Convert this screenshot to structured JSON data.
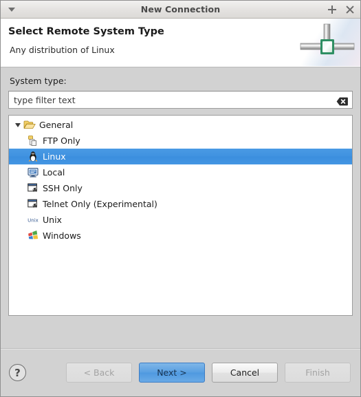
{
  "window": {
    "title": "New Connection",
    "menu_icon": "chevron-down-icon",
    "maximize_label": "+",
    "close_label": "×"
  },
  "banner": {
    "title": "Select Remote System Type",
    "subtitle": "Any distribution of Linux",
    "art_icon": "network-connection-icon"
  },
  "form": {
    "system_type_label": "System type:",
    "filter_value": "type filter text",
    "filter_placeholder": "type filter text",
    "clear_icon": "clear-backspace-icon"
  },
  "tree": {
    "root": {
      "label": "General",
      "icon": "open-folder-icon",
      "expander": "triangle-down-icon",
      "expanded": true
    },
    "items": [
      {
        "label": "FTP Only",
        "icon": "ftp-pages-icon",
        "selected": false
      },
      {
        "label": "Linux",
        "icon": "linux-penguin-icon",
        "selected": true
      },
      {
        "label": "Local",
        "icon": "local-monitor-icon",
        "selected": false
      },
      {
        "label": "SSH Only",
        "icon": "ssh-window-icon",
        "selected": false
      },
      {
        "label": "Telnet Only (Experimental)",
        "icon": "telnet-window-icon",
        "selected": false
      },
      {
        "label": "Unix",
        "icon": "unix-text-icon",
        "selected": false
      },
      {
        "label": "Windows",
        "icon": "windows-flag-icon",
        "selected": false
      }
    ]
  },
  "footer": {
    "help_label": "?",
    "help_icon": "help-question-icon",
    "buttons": [
      {
        "label": "< Back",
        "state": "disabled"
      },
      {
        "label": "Next >",
        "state": "primary"
      },
      {
        "label": "Cancel",
        "state": "normal"
      },
      {
        "label": "Finish",
        "state": "disabled"
      }
    ]
  },
  "colors": {
    "selection_blue": "#3f92e0",
    "primary_button": "#5aa0e2",
    "dialog_background": "#d2d2d2",
    "folder_yellow": "#f0c04a"
  }
}
